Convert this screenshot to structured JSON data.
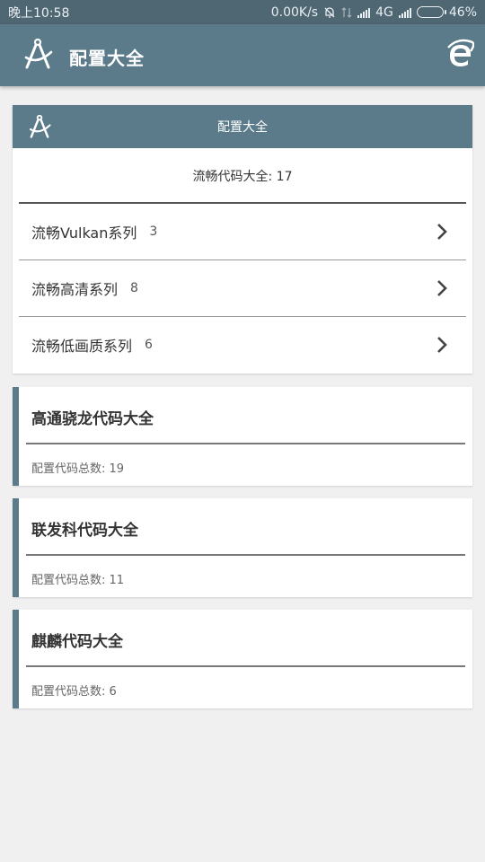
{
  "status_bar": {
    "time": "晚上10:58",
    "speed": "0.00K/s",
    "network": "4G",
    "battery": "46%",
    "battery_level": 0.46,
    "icons": [
      "alarm-off-icon",
      "data-transfer-icon",
      "signal-icon",
      "signal-icon",
      "battery-icon"
    ]
  },
  "app_bar": {
    "title": "配置大全",
    "logo_icon": "compass-a-icon",
    "action_icon": "ie-browser-icon"
  },
  "config_card": {
    "header_title": "配置大全",
    "summary": "流畅代码大全: 17",
    "items": [
      {
        "label": "流畅Vulkan系列",
        "count": "3"
      },
      {
        "label": "流畅高清系列",
        "count": "8"
      },
      {
        "label": "流畅低画质系列",
        "count": "6"
      }
    ]
  },
  "chips": [
    {
      "title": "高通骁龙代码大全",
      "count_label": "配置代码总数:",
      "count": "19"
    },
    {
      "title": "联发科代码大全",
      "count_label": "配置代码总数:",
      "count": "11"
    },
    {
      "title": "麒麟代码大全",
      "count_label": "配置代码总数:",
      "count": "6"
    }
  ],
  "colors": {
    "status_bar": "#4f6673",
    "app_bar": "#5b7b8a",
    "background": "#f0f0f0"
  }
}
